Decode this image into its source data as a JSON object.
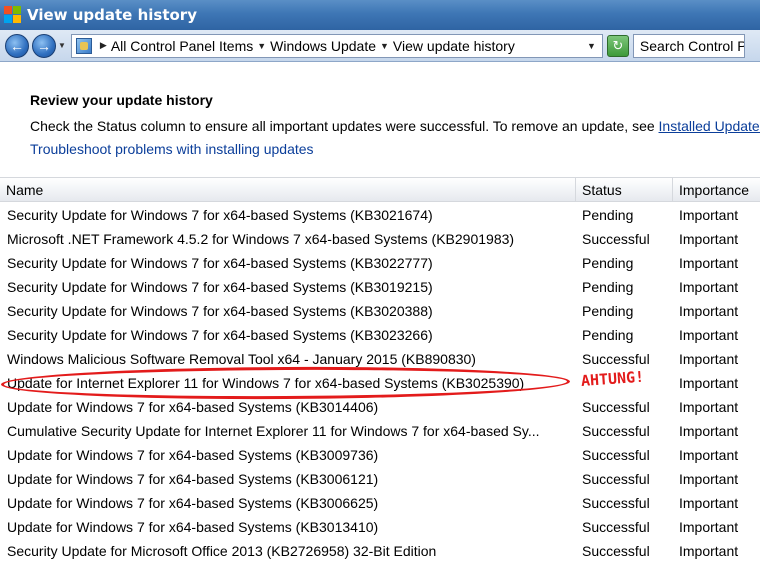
{
  "window": {
    "title": "View update history"
  },
  "toolbar": {
    "back_label": "←",
    "forward_label": "→",
    "breadcrumbs": [
      "All Control Panel Items",
      "Windows Update",
      "View update history"
    ],
    "refresh_label": "↻",
    "search_placeholder": "Search Control Panel"
  },
  "header": {
    "title": "Review your update history",
    "description": "Check the Status column to ensure all important updates were successful. To remove an update, see ",
    "installed_link": "Installed Updates",
    "description_end": ".",
    "troubleshoot_link": "Troubleshoot problems with installing updates"
  },
  "table": {
    "columns": [
      "Name",
      "Status",
      "Importance"
    ],
    "rows": [
      {
        "name": "Security Update for Windows 7 for x64-based Systems (KB3021674)",
        "status": "Pending",
        "importance": "Important"
      },
      {
        "name": "Microsoft .NET Framework 4.5.2 for Windows 7 x64-based Systems (KB2901983)",
        "status": "Successful",
        "importance": "Important"
      },
      {
        "name": "Security Update for Windows 7 for x64-based Systems (KB3022777)",
        "status": "Pending",
        "importance": "Important"
      },
      {
        "name": "Security Update for Windows 7 for x64-based Systems (KB3019215)",
        "status": "Pending",
        "importance": "Important"
      },
      {
        "name": "Security Update for Windows 7 for x64-based Systems (KB3020388)",
        "status": "Pending",
        "importance": "Important"
      },
      {
        "name": "Security Update for Windows 7 for x64-based Systems (KB3023266)",
        "status": "Pending",
        "importance": "Important"
      },
      {
        "name": "Windows Malicious Software Removal Tool x64 - January 2015 (KB890830)",
        "status": "Successful",
        "importance": "Important"
      },
      {
        "name": "Update for Internet Explorer 11 for Windows 7 for x64-based Systems (KB3025390)",
        "status": "",
        "importance": "Important"
      },
      {
        "name": "Update for Windows 7 for x64-based Systems (KB3014406)",
        "status": "Successful",
        "importance": "Important"
      },
      {
        "name": "Cumulative Security Update for Internet Explorer 11 for Windows 7 for x64-based Sy...",
        "status": "Successful",
        "importance": "Important"
      },
      {
        "name": "Update for Windows 7 for x64-based Systems (KB3009736)",
        "status": "Successful",
        "importance": "Important"
      },
      {
        "name": "Update for Windows 7 for x64-based Systems (KB3006121)",
        "status": "Successful",
        "importance": "Important"
      },
      {
        "name": "Update for Windows 7 for x64-based Systems (KB3006625)",
        "status": "Successful",
        "importance": "Important"
      },
      {
        "name": "Update for Windows 7 for x64-based Systems (KB3013410)",
        "status": "Successful",
        "importance": "Important"
      },
      {
        "name": "Security Update for Microsoft Office 2013 (KB2726958) 32-Bit Edition",
        "status": "Successful",
        "importance": "Important"
      }
    ]
  },
  "annotation": {
    "text": "AHTUNG!",
    "color": "#e31b1b"
  },
  "colors": {
    "titlebar": "#3e76b5",
    "link": "#0b3e9a"
  }
}
